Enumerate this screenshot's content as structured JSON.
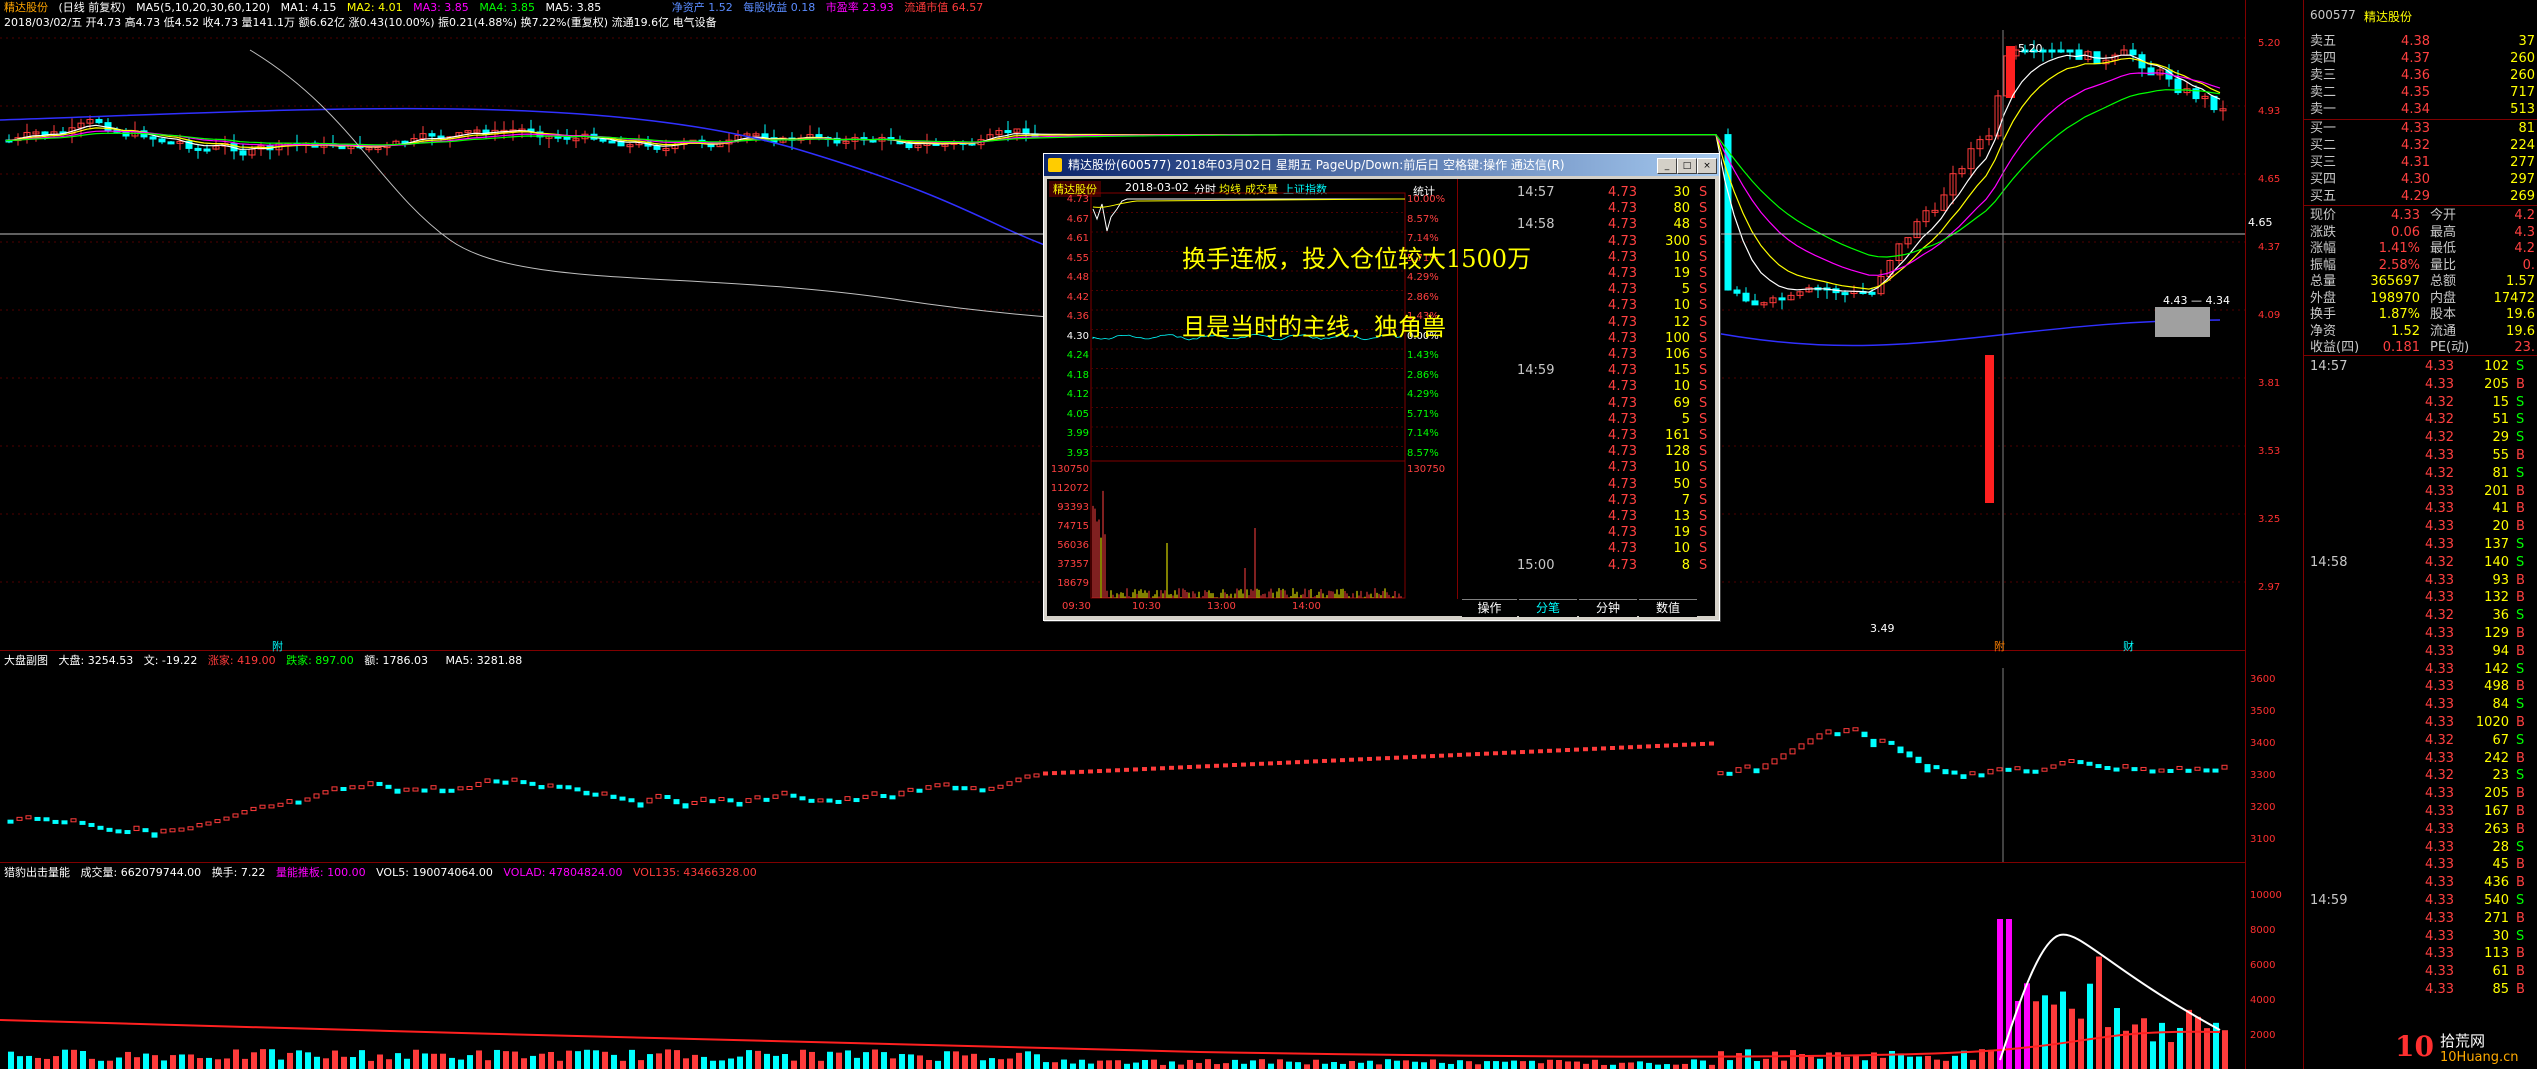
{
  "topbar": {
    "items": [
      "精达股份",
      "(日线 前复权)",
      "MA5(5,10,20,30,60,120)",
      "MA1: 4.15",
      "MA2: 4.01",
      "MA3: 3.85",
      "MA4: 3.85",
      "MA5: 3.85",
      "净资产 1.52",
      "每股收益 0.18",
      "市盈率 23.93",
      "流通市值 64.57"
    ]
  },
  "info_line": "2018/03/02/五  开4.73 高4.73 低4.52 收4.73 量141.1万 额6.62亿 涨0.43(10.00%) 振0.21(4.88%) 换7.22%(重复权) 流通19.6亿 电气设备",
  "sub1_header": {
    "name": "大盘副图",
    "items": [
      "大盘: 3254.53",
      "文: -19.22",
      "涨家: 419.00",
      "跌家: 897.00",
      "额: 1786.03",
      "",
      "MA5: 3281.88"
    ]
  },
  "sub2_header": {
    "name": "猎豹出击量能",
    "items": [
      "成交量: 662079744.00",
      "换手: 7.22",
      "量能推板: 100.00",
      "VOL5: 190074064.00",
      "VOLAD: 47804824.00",
      "VOL135: 43466328.00"
    ]
  },
  "right_axis": {
    "main": [
      "5.20",
      "4.93",
      "4.65",
      "4.37",
      "4.09",
      "3.81",
      "3.53",
      "3.25",
      "2.97"
    ],
    "sub1": [
      "3600",
      "3500",
      "3400",
      "3300",
      "3200",
      "3100"
    ],
    "sub2": [
      "10000",
      "8000",
      "6000",
      "4000",
      "2000"
    ]
  },
  "main_labels": {
    "high": "5.20",
    "low": "3.49",
    "cursor_price": "4.65",
    "hi_pair": "4.43 — 4.34"
  },
  "main_chart_marks": {
    "t1": "附",
    "t2": "财"
  },
  "stock_header": {
    "code": "600577",
    "name": "精达股份"
  },
  "order_book": [
    {
      "label": "卖五",
      "price": "4.38",
      "vol": "37"
    },
    {
      "label": "卖四",
      "price": "4.37",
      "vol": "260"
    },
    {
      "label": "卖三",
      "price": "4.36",
      "vol": "260"
    },
    {
      "label": "卖二",
      "price": "4.35",
      "vol": "717"
    },
    {
      "label": "卖一",
      "price": "4.34",
      "vol": "513"
    },
    {
      "label": "买一",
      "price": "4.33",
      "vol": "81"
    },
    {
      "label": "买二",
      "price": "4.32",
      "vol": "224"
    },
    {
      "label": "买三",
      "price": "4.31",
      "vol": "277"
    },
    {
      "label": "买四",
      "price": "4.30",
      "vol": "297"
    },
    {
      "label": "买五",
      "price": "4.29",
      "vol": "269"
    }
  ],
  "quotes": [
    {
      "l1": "现价",
      "v1": "4.33",
      "l2": "今开",
      "v2": "4.2"
    },
    {
      "l1": "涨跌",
      "v1": "0.06",
      "l2": "最高",
      "v2": "4.3"
    },
    {
      "l1": "涨幅",
      "v1": "1.41%",
      "l2": "最低",
      "v2": "4.2"
    },
    {
      "l1": "振幅",
      "v1": "2.58%",
      "l2": "量比",
      "v2": "0."
    },
    {
      "l1": "总量",
      "v1": "365697",
      "l2": "总额",
      "v2": "1.57"
    },
    {
      "l1": "外盘",
      "v1": "198970",
      "l2": "内盘",
      "v2": "17472"
    },
    {
      "l1": "换手",
      "v1": "1.87%",
      "l2": "股本",
      "v2": "19.6"
    },
    {
      "l1": "净资",
      "v1": "1.52",
      "l2": "流通",
      "v2": "19.6"
    },
    {
      "l1": "收益(四)",
      "v1": "0.181",
      "l2": "PE(动)",
      "v2": "23."
    }
  ],
  "ticks": [
    {
      "t": "14:57",
      "p": "4.33",
      "v": "102",
      "s": "S"
    },
    {
      "t": "",
      "p": "4.33",
      "v": "205",
      "s": "B"
    },
    {
      "t": "",
      "p": "4.32",
      "v": "15",
      "s": "S"
    },
    {
      "t": "",
      "p": "4.32",
      "v": "51",
      "s": "S"
    },
    {
      "t": "",
      "p": "4.32",
      "v": "29",
      "s": "S"
    },
    {
      "t": "",
      "p": "4.33",
      "v": "55",
      "s": "B"
    },
    {
      "t": "",
      "p": "4.32",
      "v": "81",
      "s": "S"
    },
    {
      "t": "",
      "p": "4.33",
      "v": "201",
      "s": "B"
    },
    {
      "t": "",
      "p": "4.33",
      "v": "41",
      "s": "B"
    },
    {
      "t": "",
      "p": "4.33",
      "v": "20",
      "s": "B"
    },
    {
      "t": "",
      "p": "4.33",
      "v": "137",
      "s": "S"
    },
    {
      "t": "14:58",
      "p": "4.32",
      "v": "140",
      "s": "S"
    },
    {
      "t": "",
      "p": "4.33",
      "v": "93",
      "s": "B"
    },
    {
      "t": "",
      "p": "4.33",
      "v": "132",
      "s": "B"
    },
    {
      "t": "",
      "p": "4.32",
      "v": "36",
      "s": "S"
    },
    {
      "t": "",
      "p": "4.33",
      "v": "129",
      "s": "B"
    },
    {
      "t": "",
      "p": "4.33",
      "v": "94",
      "s": "B"
    },
    {
      "t": "",
      "p": "4.33",
      "v": "142",
      "s": "S"
    },
    {
      "t": "",
      "p": "4.33",
      "v": "498",
      "s": "B"
    },
    {
      "t": "",
      "p": "4.33",
      "v": "84",
      "s": "S"
    },
    {
      "t": "",
      "p": "4.33",
      "v": "1020",
      "s": "B"
    },
    {
      "t": "",
      "p": "4.32",
      "v": "67",
      "s": "S"
    },
    {
      "t": "",
      "p": "4.33",
      "v": "242",
      "s": "B"
    },
    {
      "t": "",
      "p": "4.32",
      "v": "23",
      "s": "S"
    },
    {
      "t": "",
      "p": "4.33",
      "v": "205",
      "s": "B"
    },
    {
      "t": "",
      "p": "4.33",
      "v": "167",
      "s": "B"
    },
    {
      "t": "",
      "p": "4.33",
      "v": "263",
      "s": "B"
    },
    {
      "t": "",
      "p": "4.33",
      "v": "28",
      "s": "S"
    },
    {
      "t": "",
      "p": "4.33",
      "v": "45",
      "s": "B"
    },
    {
      "t": "",
      "p": "4.33",
      "v": "436",
      "s": "B"
    },
    {
      "t": "14:59",
      "p": "4.33",
      "v": "540",
      "s": "S"
    },
    {
      "t": "",
      "p": "4.33",
      "v": "271",
      "s": "B"
    },
    {
      "t": "",
      "p": "4.33",
      "v": "30",
      "s": "S"
    },
    {
      "t": "",
      "p": "4.33",
      "v": "113",
      "s": "B"
    },
    {
      "t": "",
      "p": "4.33",
      "v": "61",
      "s": "B"
    },
    {
      "t": "",
      "p": "4.33",
      "v": "85",
      "s": "B"
    }
  ],
  "popup": {
    "title": "精达股份(600577) 2018年03月02日 星期五 PageUp/Down:前后日 空格键:操作 通达信(R)",
    "tab_stock": "精达股份",
    "date_line": "2018-03-02",
    "chart_items": [
      "分时",
      "均线",
      "成交量",
      "上证指数"
    ],
    "stats_label": "统计",
    "left_prices": [
      "4.73",
      "4.67",
      "4.61",
      "4.55",
      "4.48",
      "4.42",
      "4.36",
      "4.30",
      "4.24",
      "4.18",
      "4.12",
      "4.05",
      "3.99",
      "3.93"
    ],
    "right_pcts": [
      "10.00%",
      "8.57%",
      "7.14%",
      "5.71%",
      "4.29%",
      "2.86%",
      "1.43%",
      "0.00%",
      "1.43%",
      "2.86%",
      "4.29%",
      "5.71%",
      "7.14%",
      "8.57%"
    ],
    "vol_ticks": [
      "130750",
      "112072",
      "93393",
      "74715",
      "56036",
      "37357",
      "18679"
    ],
    "time_axis": [
      "09:30",
      "10:30",
      "13:00",
      "14:00"
    ],
    "note1": "换手连板，投入仓位较大1500万",
    "note2": "且是当时的主线，独角兽",
    "tick_rows": [
      {
        "t": "14:57",
        "p": "4.73",
        "v": "30",
        "s": "S"
      },
      {
        "t": "",
        "p": "4.73",
        "v": "80",
        "s": "S"
      },
      {
        "t": "14:58",
        "p": "4.73",
        "v": "48",
        "s": "S"
      },
      {
        "t": "",
        "p": "4.73",
        "v": "300",
        "s": "S"
      },
      {
        "t": "",
        "p": "4.73",
        "v": "10",
        "s": "S"
      },
      {
        "t": "",
        "p": "4.73",
        "v": "19",
        "s": "S"
      },
      {
        "t": "",
        "p": "4.73",
        "v": "5",
        "s": "S"
      },
      {
        "t": "",
        "p": "4.73",
        "v": "10",
        "s": "S"
      },
      {
        "t": "",
        "p": "4.73",
        "v": "12",
        "s": "S"
      },
      {
        "t": "",
        "p": "4.73",
        "v": "100",
        "s": "S"
      },
      {
        "t": "",
        "p": "4.73",
        "v": "106",
        "s": "S"
      },
      {
        "t": "14:59",
        "p": "4.73",
        "v": "15",
        "s": "S"
      },
      {
        "t": "",
        "p": "4.73",
        "v": "10",
        "s": "S"
      },
      {
        "t": "",
        "p": "4.73",
        "v": "69",
        "s": "S"
      },
      {
        "t": "",
        "p": "4.73",
        "v": "5",
        "s": "S"
      },
      {
        "t": "",
        "p": "4.73",
        "v": "161",
        "s": "S"
      },
      {
        "t": "",
        "p": "4.73",
        "v": "128",
        "s": "S"
      },
      {
        "t": "",
        "p": "4.73",
        "v": "10",
        "s": "S"
      },
      {
        "t": "",
        "p": "4.73",
        "v": "50",
        "s": "S"
      },
      {
        "t": "",
        "p": "4.73",
        "v": "7",
        "s": "S"
      },
      {
        "t": "",
        "p": "4.73",
        "v": "13",
        "s": "S"
      },
      {
        "t": "",
        "p": "4.73",
        "v": "19",
        "s": "S"
      },
      {
        "t": "",
        "p": "4.73",
        "v": "10",
        "s": "S"
      },
      {
        "t": "15:00",
        "p": "4.73",
        "v": "8",
        "s": "S"
      }
    ],
    "tabs": [
      "操作",
      "分笔",
      "分钟",
      "数值"
    ]
  },
  "watermark": {
    "brand": "拾荒网",
    "site": "10Huang.cn"
  },
  "colors": {
    "up": "#ff3b3b",
    "down": "#00ffff",
    "ma_white": "#ffffff",
    "ma_yellow": "#ffff00",
    "ma_magenta": "#ff00ff",
    "ma_green": "#00ff00",
    "ma_blue": "#3030ff",
    "grid": "#800000"
  }
}
